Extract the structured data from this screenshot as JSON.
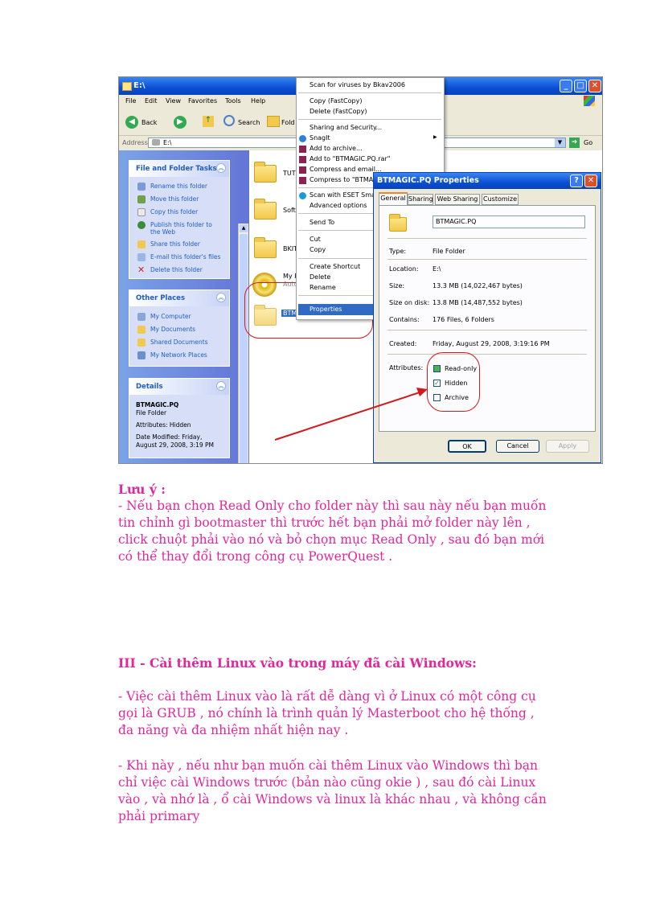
{
  "explorer": {
    "title": "E:\\",
    "menu": [
      "File",
      "Edit",
      "View",
      "Favorites",
      "Tools",
      "Help"
    ],
    "toolbar": {
      "back": "Back",
      "search": "Search",
      "folders": "Fold"
    },
    "address_label": "Address",
    "address_value": "E:\\",
    "go": "Go",
    "tasks_panel": {
      "title": "File and Folder Tasks",
      "items": [
        "Rename this folder",
        "Move this folder",
        "Copy this folder",
        "Publish this folder to",
        "the Web",
        "Share this folder",
        "E-mail this folder's files",
        "Delete this folder"
      ]
    },
    "places_panel": {
      "title": "Other Places",
      "items": [
        "My Computer",
        "My Documents",
        "Shared Documents",
        "My Network Places"
      ]
    },
    "details_panel": {
      "title": "Details",
      "name": "BTMAGIC.PQ",
      "kind": "File Folder",
      "attributes": "Attributes: Hidden",
      "modified_1": "Date Modified: Friday,",
      "modified_2": "August 29, 2008, 3:19 PM"
    },
    "files": [
      "TUT",
      "Softy",
      "BKIT",
      "My P",
      "Auto",
      "BTM"
    ]
  },
  "context_menu": {
    "items": [
      "Scan for viruses by Bkav2006",
      "Copy (FastCopy)",
      "Delete (FastCopy)",
      "Sharing and Security...",
      "SnagIt",
      "Add to archive...",
      "Add to \"BTMAGIC.PQ.rar\"",
      "Compress and email...",
      "Compress to \"BTMAGI",
      "Scan with ESET Smart",
      "Advanced options",
      "Send To",
      "Cut",
      "Copy",
      "Create Shortcut",
      "Delete",
      "Rename",
      "Properties"
    ]
  },
  "dialog": {
    "title": "BTMAGIC.PQ Properties",
    "tabs": [
      "General",
      "Sharing",
      "Web Sharing",
      "Customize"
    ],
    "name": "BTMAGIC.PQ",
    "rows": [
      {
        "label": "Type:",
        "value": "File Folder"
      },
      {
        "label": "Location:",
        "value": "E:\\"
      },
      {
        "label": "Size:",
        "value": "13.3 MB (14,022,467 bytes)"
      },
      {
        "label": "Size on disk:",
        "value": "13.8 MB (14,487,552 bytes)"
      },
      {
        "label": "Contains:",
        "value": "176 Files, 6 Folders"
      },
      {
        "label": "Created:",
        "value": "Friday, August 29, 2008, 3:19:16 PM"
      }
    ],
    "attributes_label": "Attributes:",
    "attributes": [
      {
        "label": "Read-only",
        "checked": "partial"
      },
      {
        "label": "Hidden",
        "checked": "yes"
      },
      {
        "label": "Archive",
        "checked": "no"
      }
    ],
    "buttons": {
      "ok": "OK",
      "cancel": "Cancel",
      "apply": "Apply"
    }
  },
  "text": {
    "note_title": "Lưu ý :",
    "note_body": "- Nếu bạn chọn Read Only cho folder này thì sau này nếu bạn muốn tin chỉnh gì bootmaster thì trước hết bạn phải mở folder này lên , click chuột phải vào nó và bỏ chọn mục Read Only , sau đó bạn mới có thể thay đổi trong công cụ PowerQuest .",
    "section_title": "III - Cài thêm Linux vào trong máy đã cài Windows:",
    "para1": "- Việc cài thêm Linux vào là rất dễ dàng vì ở Linux có một công cụ gọi là GRUB , nó chính là trình quản lý Masterboot cho hệ thống , đa năng và đa nhiệm nhất hiện nay .",
    "para2": "- Khi này , nếu như bạn muốn cài thêm Linux vào Windows thì bạn chỉ việc cài Windows trước (bản nào cũng okie ) , sau đó cài Linux vào , và nhớ là , ổ cài Windows và linux là khác nhau , và không cần phải primary"
  },
  "colors": {
    "text": "#e0279c",
    "xp_blue": "#0a4fd6",
    "annotation": "#d3191b"
  }
}
